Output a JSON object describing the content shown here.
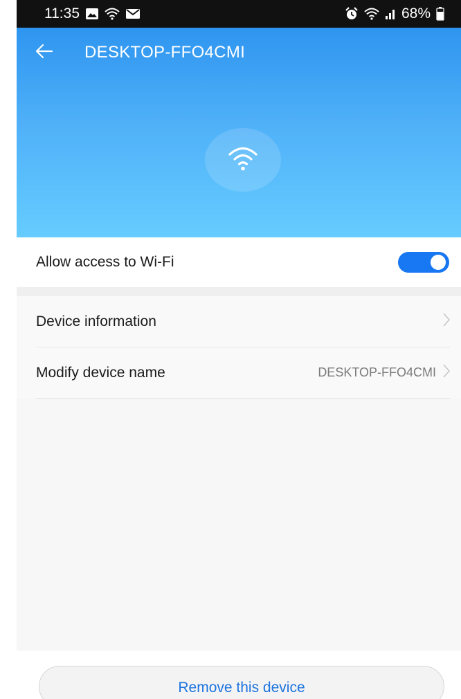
{
  "status_bar": {
    "time": "11:35",
    "battery": "68%",
    "left_icons": [
      "image-icon",
      "wifi-icon",
      "mail-icon"
    ],
    "right_icons": [
      "alarm-icon",
      "wifi-icon",
      "signal-icon",
      "battery-icon"
    ]
  },
  "header": {
    "title": "DESKTOP-FFO4CMI",
    "back_icon": "arrow-left-icon",
    "hero_icon": "wifi-icon"
  },
  "settings": {
    "wifi_access_label": "Allow access to Wi-Fi",
    "wifi_access_enabled": true,
    "items": [
      {
        "label": "Device information",
        "value": ""
      },
      {
        "label": "Modify device name",
        "value": "DESKTOP-FFO4CMI"
      }
    ]
  },
  "actions": {
    "remove_label": "Remove this device"
  },
  "colors": {
    "accent": "#1877f2",
    "header_top": "#2e95f0",
    "header_bottom": "#66ccff",
    "link_text": "#1c74e0"
  }
}
